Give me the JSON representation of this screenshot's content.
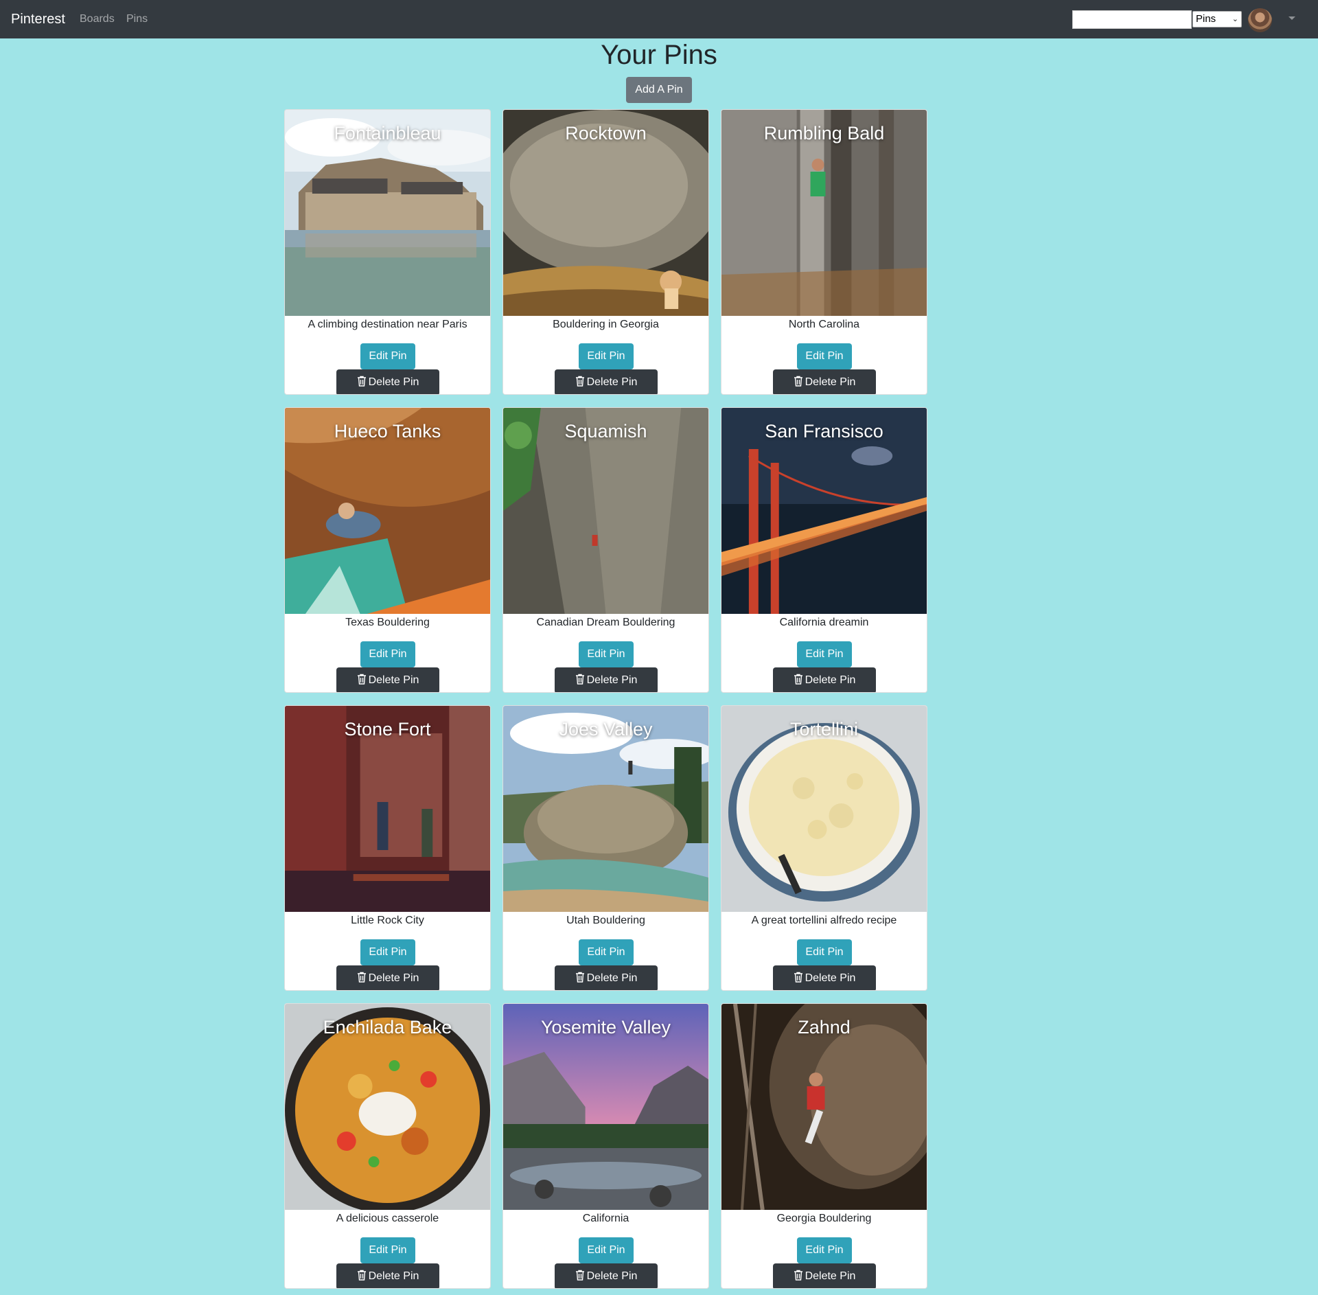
{
  "navbar": {
    "brand": "Pinterest",
    "links": [
      "Boards",
      "Pins"
    ],
    "search_value": "",
    "search_type": "Pins"
  },
  "header": {
    "title": "Your Pins",
    "add_label": "Add A Pin"
  },
  "pins": [
    {
      "title": "Fontainbleau",
      "description": "A climbing destination near Paris",
      "edit_label": "Edit Pin",
      "delete_label": "Delete Pin"
    },
    {
      "title": "Rocktown",
      "description": "Bouldering in Georgia",
      "edit_label": "Edit Pin",
      "delete_label": "Delete Pin"
    },
    {
      "title": "Rumbling Bald",
      "description": "North Carolina",
      "edit_label": "Edit Pin",
      "delete_label": "Delete Pin"
    },
    {
      "title": "Hueco Tanks",
      "description": "Texas Bouldering",
      "edit_label": "Edit Pin",
      "delete_label": "Delete Pin"
    },
    {
      "title": "Squamish",
      "description": "Canadian Dream Bouldering",
      "edit_label": "Edit Pin",
      "delete_label": "Delete Pin"
    },
    {
      "title": "San Fransisco",
      "description": "California dreamin",
      "edit_label": "Edit Pin",
      "delete_label": "Delete Pin"
    },
    {
      "title": "Stone Fort",
      "description": "Little Rock City",
      "edit_label": "Edit Pin",
      "delete_label": "Delete Pin"
    },
    {
      "title": "Joes Valley",
      "description": "Utah Bouldering",
      "edit_label": "Edit Pin",
      "delete_label": "Delete Pin"
    },
    {
      "title": "Tortellini",
      "description": "A great tortellini alfredo recipe",
      "edit_label": "Edit Pin",
      "delete_label": "Delete Pin"
    },
    {
      "title": "Enchilada Bake",
      "description": "A delicious casserole",
      "edit_label": "Edit Pin",
      "delete_label": "Delete Pin"
    },
    {
      "title": "Yosemite Valley",
      "description": "California",
      "edit_label": "Edit Pin",
      "delete_label": "Delete Pin"
    },
    {
      "title": "Zahnd",
      "description": "Georgia Bouldering",
      "edit_label": "Edit Pin",
      "delete_label": "Delete Pin"
    }
  ],
  "colors": {
    "page_background": "#9fe4e7",
    "navbar": "#343a40",
    "edit_button": "#30a2b9",
    "delete_button": "#343a40",
    "add_button": "#6c757d"
  }
}
